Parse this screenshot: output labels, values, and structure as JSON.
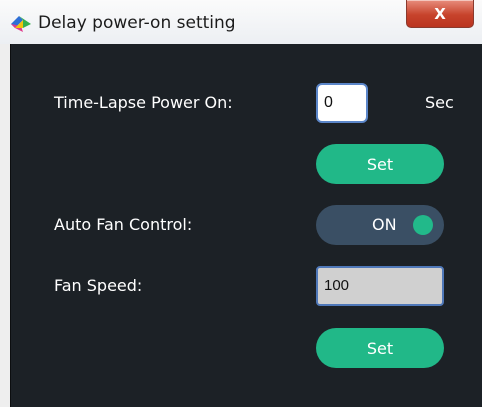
{
  "window": {
    "title": "Delay power-on setting",
    "close_label": "X"
  },
  "form": {
    "time_lapse_label": "Time-Lapse Power On:",
    "time_lapse_value": "0",
    "time_lapse_unit": "Sec",
    "set_label": "Set",
    "auto_fan_label": "Auto Fan Control:",
    "auto_fan_state": "ON",
    "fan_speed_label": "Fan Speed:",
    "fan_speed_value": "100",
    "set_label_2": "Set"
  },
  "colors": {
    "panel_bg": "#1c2126",
    "accent_green": "#21b888",
    "toggle_bg": "#3a4f64",
    "close_red": "#c7432c"
  },
  "icons": {
    "app": "app-logo-icon",
    "close": "close-icon"
  }
}
